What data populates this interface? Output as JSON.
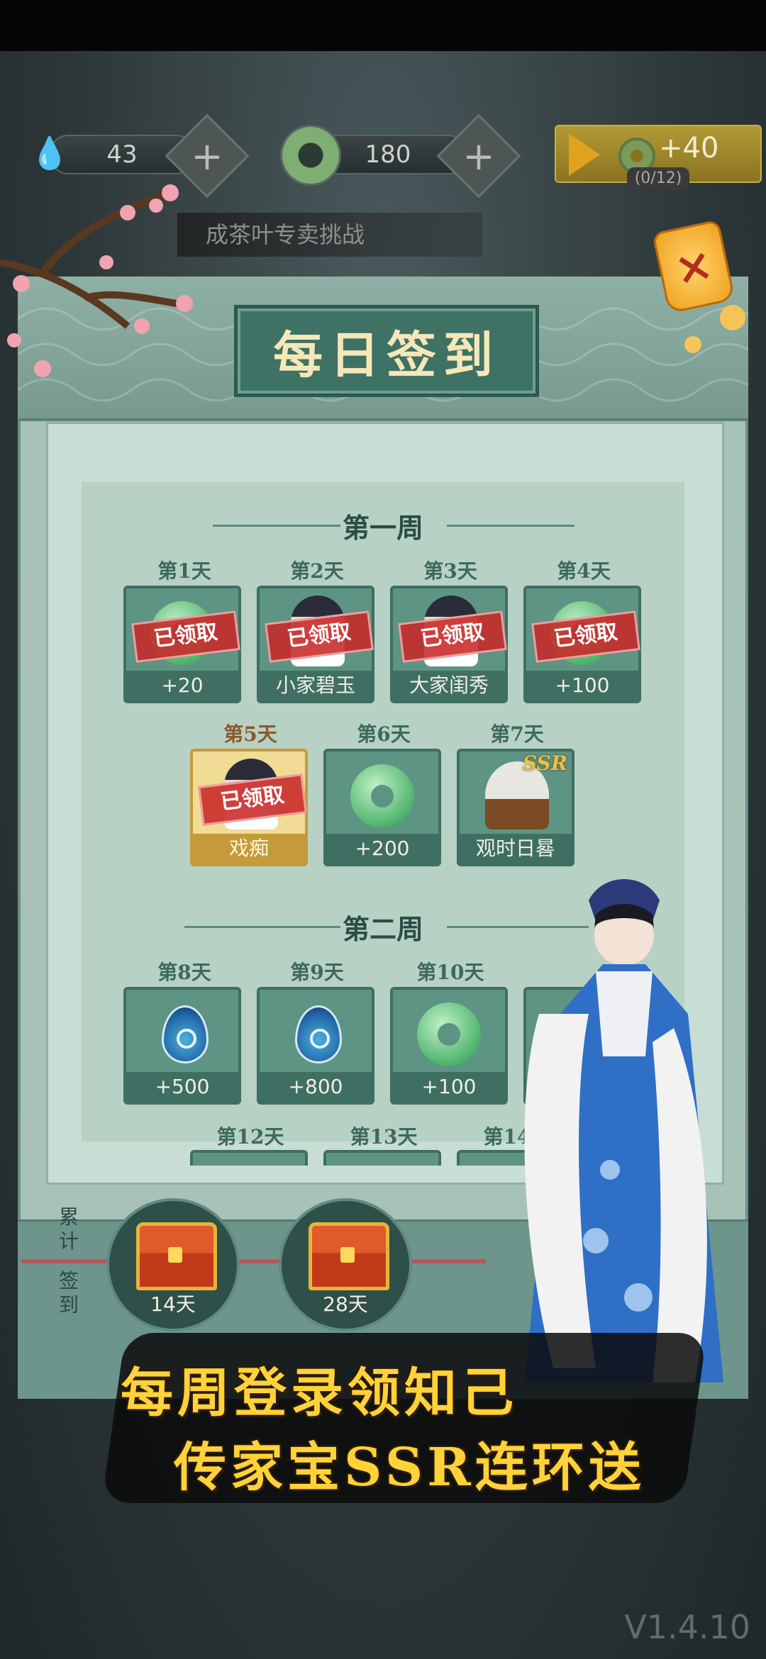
{
  "resources": {
    "drop_value": "43",
    "jade_value": "180",
    "ad_reward": "+40",
    "ad_count": "(0/12)"
  },
  "task_banner": "成茶叶专卖挑战",
  "panel": {
    "title": "每日签到",
    "close_glyph": "×"
  },
  "claimed_stamp": "已领取",
  "weeks": [
    {
      "title": "第一周",
      "days": [
        {
          "label": "第1天",
          "reward": "+20",
          "icon": "jade-icon",
          "claimed": true
        },
        {
          "label": "第2天",
          "reward": "小家碧玉",
          "icon": "character-portrait-icon",
          "claimed": true
        },
        {
          "label": "第3天",
          "reward": "大家闺秀",
          "icon": "character-portrait-icon",
          "claimed": true
        },
        {
          "label": "第4天",
          "reward": "+100",
          "icon": "jade-icon",
          "claimed": true
        },
        {
          "label": "第5天",
          "reward": "戏痴",
          "icon": "character-portrait-icon",
          "claimed": true,
          "highlight": true
        },
        {
          "label": "第6天",
          "reward": "+200",
          "icon": "jade-icon",
          "claimed": false
        },
        {
          "label": "第7天",
          "reward": "观时日晷",
          "icon": "sundial-icon",
          "claimed": false,
          "tag": "SSR"
        }
      ]
    },
    {
      "title": "第二周",
      "days": [
        {
          "label": "第8天",
          "reward": "+500",
          "icon": "water-drop-icon"
        },
        {
          "label": "第9天",
          "reward": "+800",
          "icon": "water-drop-icon"
        },
        {
          "label": "第10天",
          "reward": "+100",
          "icon": "jade-icon"
        },
        {
          "label": "第12天"
        },
        {
          "label": "第13天"
        },
        {
          "label": "第14天"
        }
      ]
    }
  ],
  "cumulative": {
    "label_top": "累计",
    "label_bottom": "签到",
    "milestones": [
      {
        "label": "14天",
        "icon": "treasure-chest-icon"
      },
      {
        "label": "28天",
        "icon": "treasure-chest-icon"
      }
    ]
  },
  "promo": {
    "line1": "每周登录领知己",
    "line2": "传家宝SSR连环送"
  },
  "version": "V1.4.10",
  "colors": {
    "panel_green": "#a9c2b7",
    "card_green": "#5e9484",
    "stamp_red": "#c82828",
    "gold": "#ffd23a"
  }
}
